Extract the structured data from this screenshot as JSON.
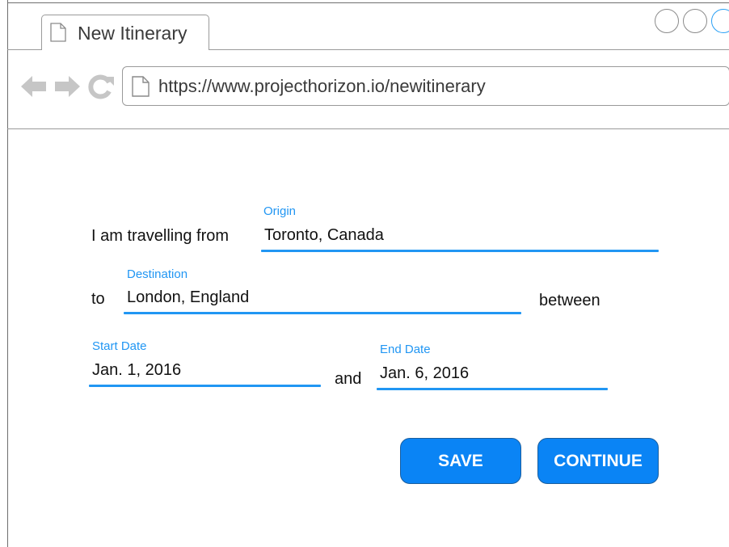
{
  "browser": {
    "tab_title": "New Itinerary",
    "url": "https://www.projecthorizon.io/newitinerary",
    "icons": [
      "document-icon",
      "back-arrow-icon",
      "forward-arrow-icon",
      "reload-icon"
    ]
  },
  "form": {
    "intro_text": "I am travelling from",
    "to_text": "to",
    "between_text": "between",
    "and_text": "and",
    "origin": {
      "label": "Origin",
      "value": "Toronto, Canada"
    },
    "destination": {
      "label": "Destination",
      "value": "London, England"
    },
    "start_date": {
      "label": "Start Date",
      "value": "Jan. 1, 2016"
    },
    "end_date": {
      "label": "End Date",
      "value": "Jan. 6, 2016"
    }
  },
  "actions": {
    "save_label": "SAVE",
    "continue_label": "CONTINUE"
  },
  "colors": {
    "accent": "#2196f3",
    "button": "#0a84f5",
    "window_control_active": "#2aa0f5"
  }
}
